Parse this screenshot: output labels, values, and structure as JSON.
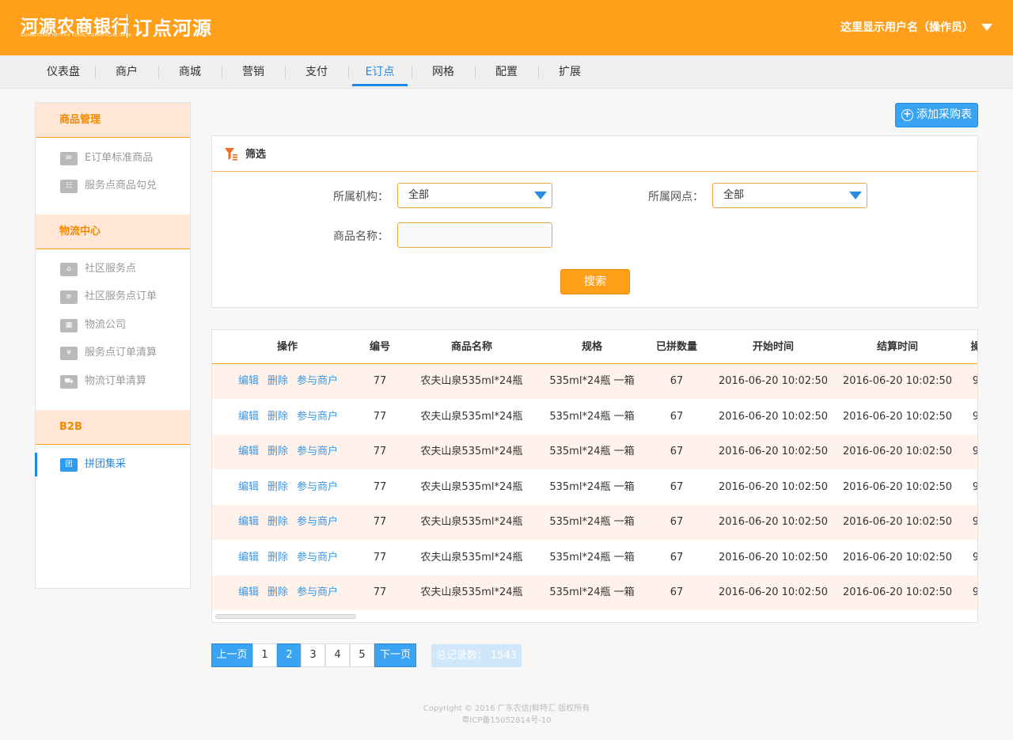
{
  "header": {
    "bank_name": "河源农商银行",
    "bank_name_en": "GUANGDONG HEYUAN RURAL COMMERCIAL BANK",
    "brand": "订点河源",
    "user_label": "这里显示用户名（操作员）",
    "color": "#ff9f1a"
  },
  "nav": {
    "items": [
      "仪表盘",
      "商户",
      "商城",
      "营销",
      "支付",
      "E订点",
      "网格",
      "配置",
      "扩展"
    ],
    "active": "E订点",
    "active_color": "#1e88e5"
  },
  "sidebar": {
    "sections": [
      {
        "title": "商品管理",
        "items": [
          "E订单标准商品",
          "服务点商品勾兑"
        ]
      },
      {
        "title": "物流中心",
        "items": [
          "社区服务点",
          "社区服务点订单",
          "物流公司",
          "服务点订单清算",
          "物流订单清算"
        ]
      },
      {
        "title": "B2B",
        "items": [
          "拼团集采"
        ]
      }
    ],
    "icons": [
      "envelope-icon",
      "list-icon",
      "store-icon",
      "order-icon",
      "building-icon",
      "yuan-icon",
      "truck-icon",
      "group-icon"
    ],
    "active_item": "拼团集采",
    "active_icon_text": "团"
  },
  "add_button": {
    "label": "添加采购表"
  },
  "filter": {
    "title": "筛选",
    "org_label": "所属机构：",
    "org_value": "全部",
    "branch_label": "所属网点：",
    "branch_value": "全部",
    "name_label": "商品名称：",
    "name_value": "",
    "search_label": "搜索"
  },
  "table": {
    "columns": [
      "操作",
      "编号",
      "商品名称",
      "规格",
      "已拼数量",
      "开始时间",
      "结算时间",
      "操"
    ],
    "actions": [
      "编辑",
      "删除",
      "参与商户"
    ],
    "rows": [
      {
        "id": "77",
        "name": "农夫山泉535ml*24瓶",
        "spec": "535ml*24瓶 一箱",
        "qty": "67",
        "start": "2016-06-20 10:02:50",
        "settle": "2016-06-20 10:02:50",
        "extra": "9"
      },
      {
        "id": "77",
        "name": "农夫山泉535ml*24瓶",
        "spec": "535ml*24瓶 一箱",
        "qty": "67",
        "start": "2016-06-20 10:02:50",
        "settle": "2016-06-20 10:02:50",
        "extra": "9"
      },
      {
        "id": "77",
        "name": "农夫山泉535ml*24瓶",
        "spec": "535ml*24瓶 一箱",
        "qty": "67",
        "start": "2016-06-20 10:02:50",
        "settle": "2016-06-20 10:02:50",
        "extra": "9"
      },
      {
        "id": "77",
        "name": "农夫山泉535ml*24瓶",
        "spec": "535ml*24瓶 一箱",
        "qty": "67",
        "start": "2016-06-20 10:02:50",
        "settle": "2016-06-20 10:02:50",
        "extra": "9"
      },
      {
        "id": "77",
        "name": "农夫山泉535ml*24瓶",
        "spec": "535ml*24瓶 一箱",
        "qty": "67",
        "start": "2016-06-20 10:02:50",
        "settle": "2016-06-20 10:02:50",
        "extra": "9"
      },
      {
        "id": "77",
        "name": "农夫山泉535ml*24瓶",
        "spec": "535ml*24瓶 一箱",
        "qty": "67",
        "start": "2016-06-20 10:02:50",
        "settle": "2016-06-20 10:02:50",
        "extra": "9"
      },
      {
        "id": "77",
        "name": "农夫山泉535ml*24瓶",
        "spec": "535ml*24瓶 一箱",
        "qty": "67",
        "start": "2016-06-20 10:02:50",
        "settle": "2016-06-20 10:02:50",
        "extra": "9"
      }
    ]
  },
  "pagination": {
    "prev": "上一页",
    "pages": [
      "1",
      "2",
      "3",
      "4",
      "5"
    ],
    "current": "2",
    "next": "下一页",
    "total_label": "总记录数：",
    "total": "1543"
  },
  "footer": {
    "copyright": "Copyright © 2016 广东农信|鲜特汇 版权所有",
    "icp": "粤ICP备15052814号-10"
  }
}
